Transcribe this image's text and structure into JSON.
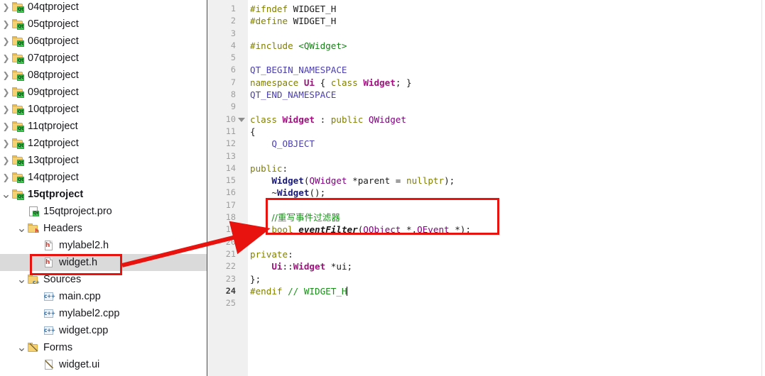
{
  "sidebar": {
    "name": "project-tree",
    "items": [
      {
        "label": "04qtproject",
        "icon": "qt-project-folder-icon",
        "indent": 0,
        "expander": "collapsed",
        "bold": false,
        "selected": false
      },
      {
        "label": "05qtproject",
        "icon": "qt-project-folder-icon",
        "indent": 0,
        "expander": "collapsed",
        "bold": false,
        "selected": false
      },
      {
        "label": "06qtproject",
        "icon": "qt-project-folder-icon",
        "indent": 0,
        "expander": "collapsed",
        "bold": false,
        "selected": false
      },
      {
        "label": "07qtproject",
        "icon": "qt-project-folder-icon",
        "indent": 0,
        "expander": "collapsed",
        "bold": false,
        "selected": false
      },
      {
        "label": "08qtproject",
        "icon": "qt-project-folder-icon",
        "indent": 0,
        "expander": "collapsed",
        "bold": false,
        "selected": false
      },
      {
        "label": "09qtproject",
        "icon": "qt-project-folder-icon",
        "indent": 0,
        "expander": "collapsed",
        "bold": false,
        "selected": false
      },
      {
        "label": "10qtproject",
        "icon": "qt-project-folder-icon",
        "indent": 0,
        "expander": "collapsed",
        "bold": false,
        "selected": false
      },
      {
        "label": "11qtproject",
        "icon": "qt-project-folder-icon",
        "indent": 0,
        "expander": "collapsed",
        "bold": false,
        "selected": false
      },
      {
        "label": "12qtproject",
        "icon": "qt-project-folder-icon",
        "indent": 0,
        "expander": "collapsed",
        "bold": false,
        "selected": false
      },
      {
        "label": "13qtproject",
        "icon": "qt-project-folder-icon",
        "indent": 0,
        "expander": "collapsed",
        "bold": false,
        "selected": false
      },
      {
        "label": "14qtproject",
        "icon": "qt-project-folder-icon",
        "indent": 0,
        "expander": "collapsed",
        "bold": false,
        "selected": false
      },
      {
        "label": "15qtproject",
        "icon": "qt-project-folder-icon",
        "indent": 0,
        "expander": "expanded",
        "bold": true,
        "selected": false
      },
      {
        "label": "15qtproject.pro",
        "icon": "qt-pro-file-icon",
        "indent": 1,
        "expander": "none",
        "bold": false,
        "selected": false
      },
      {
        "label": "Headers",
        "icon": "headers-folder-icon",
        "indent": 1,
        "expander": "expanded",
        "bold": false,
        "selected": false
      },
      {
        "label": "mylabel2.h",
        "icon": "h-file-icon",
        "indent": 2,
        "expander": "none",
        "bold": false,
        "selected": false
      },
      {
        "label": "widget.h",
        "icon": "h-file-icon",
        "indent": 2,
        "expander": "none",
        "bold": false,
        "selected": true
      },
      {
        "label": "Sources",
        "icon": "sources-folder-icon",
        "indent": 1,
        "expander": "expanded",
        "bold": false,
        "selected": false
      },
      {
        "label": "main.cpp",
        "icon": "cpp-file-icon",
        "indent": 2,
        "expander": "none",
        "bold": false,
        "selected": false
      },
      {
        "label": "mylabel2.cpp",
        "icon": "cpp-file-icon",
        "indent": 2,
        "expander": "none",
        "bold": false,
        "selected": false
      },
      {
        "label": "widget.cpp",
        "icon": "cpp-file-icon",
        "indent": 2,
        "expander": "none",
        "bold": false,
        "selected": false
      },
      {
        "label": "Forms",
        "icon": "forms-folder-icon",
        "indent": 1,
        "expander": "expanded",
        "bold": false,
        "selected": false
      },
      {
        "label": "widget.ui",
        "icon": "ui-file-icon",
        "indent": 2,
        "expander": "none",
        "bold": false,
        "selected": false
      }
    ]
  },
  "editor": {
    "name": "code-editor",
    "filename": "widget.h",
    "cursor_line": 24,
    "fold_marker_line": 10,
    "line_numbers": [
      1,
      2,
      3,
      4,
      5,
      6,
      7,
      8,
      9,
      10,
      11,
      12,
      13,
      14,
      15,
      16,
      17,
      18,
      19,
      20,
      21,
      22,
      23,
      24,
      25
    ],
    "lines": [
      {
        "n": 1,
        "text": "#ifndef WIDGET_H"
      },
      {
        "n": 2,
        "text": "#define WIDGET_H"
      },
      {
        "n": 3,
        "text": ""
      },
      {
        "n": 4,
        "text": "#include <QWidget>"
      },
      {
        "n": 5,
        "text": ""
      },
      {
        "n": 6,
        "text": "QT_BEGIN_NAMESPACE"
      },
      {
        "n": 7,
        "text": "namespace Ui { class Widget; }"
      },
      {
        "n": 8,
        "text": "QT_END_NAMESPACE"
      },
      {
        "n": 9,
        "text": ""
      },
      {
        "n": 10,
        "text": "class Widget : public QWidget"
      },
      {
        "n": 11,
        "text": "{"
      },
      {
        "n": 12,
        "text": "    Q_OBJECT"
      },
      {
        "n": 13,
        "text": ""
      },
      {
        "n": 14,
        "text": "public:"
      },
      {
        "n": 15,
        "text": "    Widget(QWidget *parent = nullptr);"
      },
      {
        "n": 16,
        "text": "    ~Widget();"
      },
      {
        "n": 17,
        "text": ""
      },
      {
        "n": 18,
        "text": "    //重写事件过滤器"
      },
      {
        "n": 19,
        "text": "    bool eventFilter(QObject *,QEvent *);"
      },
      {
        "n": 20,
        "text": ""
      },
      {
        "n": 21,
        "text": "private:"
      },
      {
        "n": 22,
        "text": "    Ui::Widget *ui;"
      },
      {
        "n": 23,
        "text": "};"
      },
      {
        "n": 24,
        "text": "#endif // WIDGET_H"
      },
      {
        "n": 25,
        "text": ""
      }
    ]
  },
  "annotations": {
    "color": "#e8120e",
    "code_highlight_box": {
      "label": "eventFilter declaration highlight"
    },
    "file_highlight_box": {
      "label": "widget.h file highlight"
    },
    "arrow": {
      "label": "arrow from widget.h to eventFilter code"
    }
  }
}
